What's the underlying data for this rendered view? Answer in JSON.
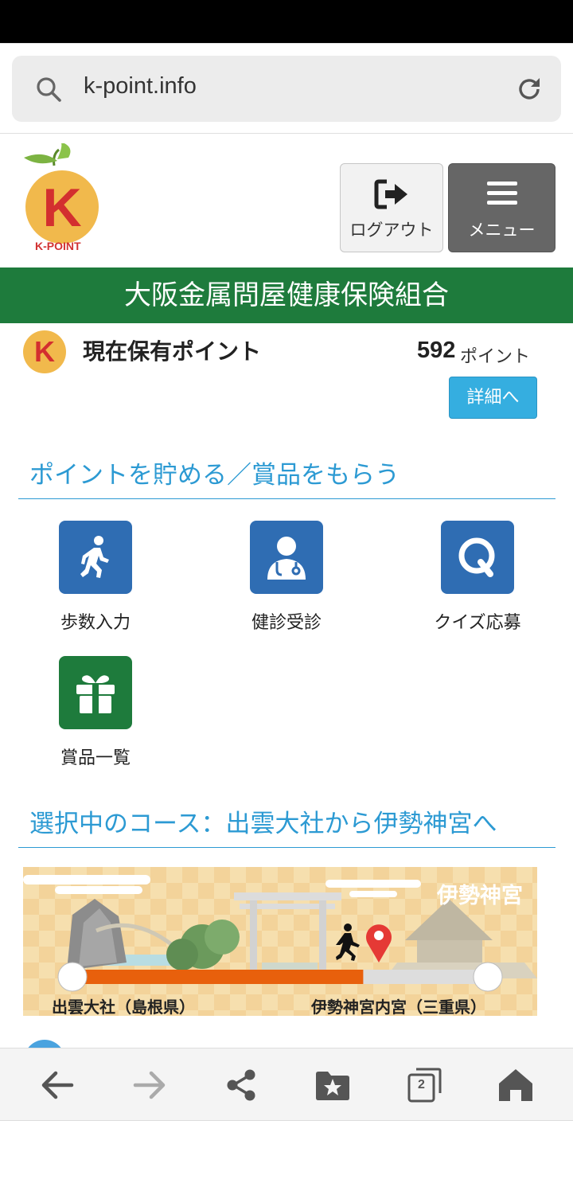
{
  "browser": {
    "url": "k-point.info",
    "tab_count": "2"
  },
  "header": {
    "logo_text": "K-POINT",
    "logout_label": "ログアウト",
    "menu_label": "メニュー"
  },
  "org_name": "大阪金属問屋健康保険組合",
  "points": {
    "label": "現在保有ポイント",
    "value": "592",
    "unit": "ポイント",
    "detail_label": "詳細へ"
  },
  "earn_section": {
    "title": "ポイントを貯める／賞品をもらう",
    "tiles": [
      {
        "label": "歩数入力",
        "icon": "walking-person-icon"
      },
      {
        "label": "健診受診",
        "icon": "doctor-icon"
      },
      {
        "label": "クイズ応募",
        "icon": "quiz-icon"
      },
      {
        "label": "賞品一覧",
        "icon": "gift-icon"
      }
    ]
  },
  "course_section": {
    "title": "選択中のコース：出雲大社から伊勢神宮へ",
    "destination_banner": "伊勢神宮",
    "start": "出雲大社（島根県）",
    "end": "伊勢神宮内宮（三重県）",
    "progress_fraction": 0.7
  },
  "colors": {
    "brand_green": "#1e7b3c",
    "accent_blue": "#2c9ad3",
    "tile_blue": "#2f6db3",
    "progress_orange": "#e8600c"
  }
}
